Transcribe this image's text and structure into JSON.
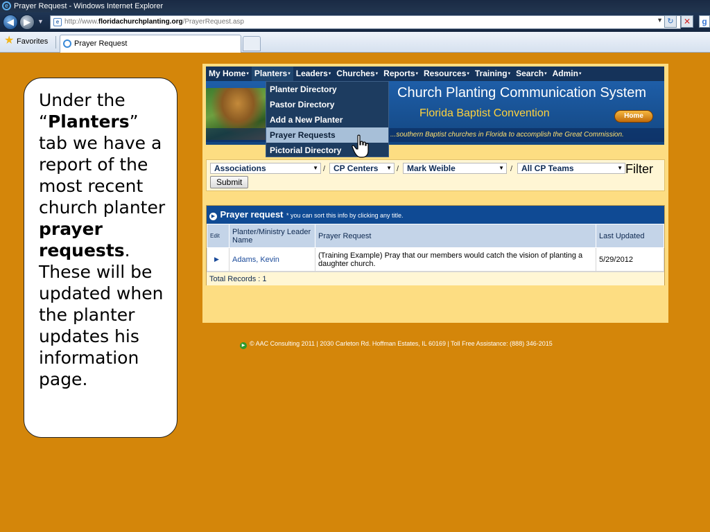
{
  "window": {
    "title": "Prayer Request - Windows Internet Explorer"
  },
  "browser": {
    "address_prefix": "http://www.",
    "address_domain": "floridachurchplanting.org",
    "address_path": "/PrayerRequest.asp",
    "favorites_label": "Favorites",
    "tab_label": "Prayer Request"
  },
  "callout": {
    "line1": "Under the “",
    "bold1": "Planters",
    "line2": "” tab we have a report of the most recent church planter ",
    "bold2": "prayer requests",
    "line3": ". These will be updated when the planter updates his information page."
  },
  "menu": {
    "items": [
      "My Home",
      "Planters",
      "Leaders",
      "Churches",
      "Reports",
      "Resources",
      "Training",
      "Search",
      "Admin"
    ],
    "caret": "▾"
  },
  "banner": {
    "title": "Church Planting Communication System",
    "subtitle": "Florida Baptist Convention",
    "home_label": "Home",
    "tagline": "...southern Baptist churches in Florida to accomplish the Great Commission."
  },
  "dropdown": {
    "items": [
      "Planter Directory",
      "Pastor Directory",
      "Add a New Planter",
      "Prayer Requests",
      "Pictorial Directory"
    ],
    "hovered_index": 3
  },
  "filters": {
    "associations": "Associations",
    "cp_centers": "CP Centers",
    "person": "Mark Weible",
    "teams": "All CP Teams",
    "separator": "/",
    "filter_label": "Filter",
    "submit_label": "Submit"
  },
  "report": {
    "title": "Prayer request",
    "note": "* you can sort this info by clicking any title.",
    "columns": [
      "Edit",
      "Planter/Ministry Leader Name",
      "Prayer Request",
      "Last Updated"
    ],
    "rows": [
      {
        "name": "Adams, Kevin",
        "request": "(Training Example) Pray that our members would catch the vision of planting a daughter church.",
        "updated": "5/29/2012"
      }
    ],
    "total": "Total Records : 1"
  },
  "footer": {
    "text": "© AAC Consulting 2011 | 2030 Carleton Rd. Hoffman Estates, IL 60169 | Toll Free Assistance: (888) 346-2015"
  },
  "colors": {
    "slide_background": "#d4860a",
    "menu_bar": "#15335a",
    "page_background": "#fddd82",
    "report_header": "#0f4a94"
  }
}
